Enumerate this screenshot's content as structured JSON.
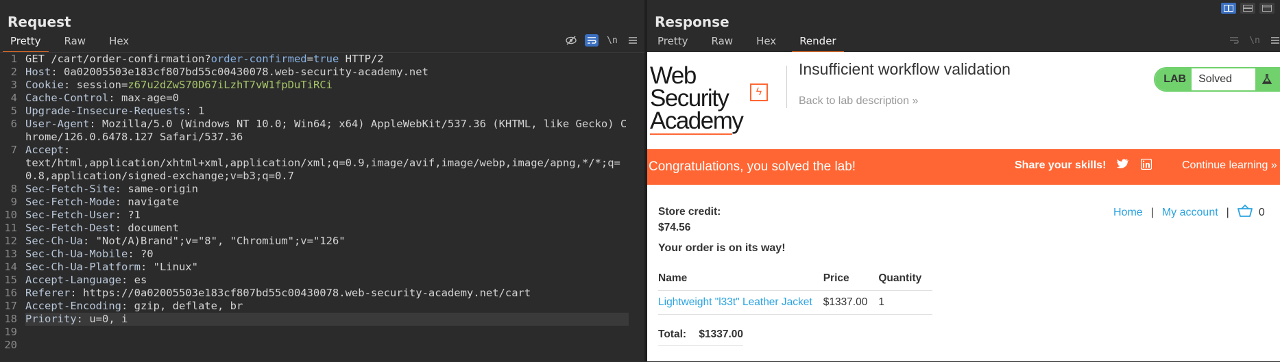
{
  "request": {
    "title": "Request",
    "tabs": [
      "Pretty",
      "Raw",
      "Hex"
    ],
    "active_tab": "Pretty",
    "tool_newline": "\\n",
    "lines": [
      {
        "n": "1",
        "segments": [
          [
            "GET /cart/order-confirmation?",
            ""
          ],
          [
            "order-confirmed",
            "q"
          ],
          [
            "=",
            ""
          ],
          [
            "true",
            "q"
          ],
          [
            " HTTP/2",
            ""
          ]
        ]
      },
      {
        "n": "2",
        "segments": [
          [
            "Host",
            "hname"
          ],
          [
            ": 0a02005503e183cf807bd55c00430078.web-security-academy.net",
            "hval"
          ]
        ]
      },
      {
        "n": "3",
        "segments": [
          [
            "Cookie",
            "hname"
          ],
          [
            ": session=",
            "hval"
          ],
          [
            "z67u2dZwS70D67iLzhT7vW1fpDuTiRCi",
            "sess"
          ]
        ]
      },
      {
        "n": "4",
        "segments": [
          [
            "Cache-Control",
            "hname"
          ],
          [
            ": max-age=0",
            "hval"
          ]
        ]
      },
      {
        "n": "5",
        "segments": [
          [
            "Upgrade-Insecure-Requests",
            "hname"
          ],
          [
            ": 1",
            "hval"
          ]
        ]
      },
      {
        "n": "6",
        "segments": [
          [
            "User-Agent",
            "hname"
          ],
          [
            ": Mozilla/5.0 (Windows NT 10.0; Win64; x64) AppleWebKit/537.36 (KHTML, like Gecko) Chrome/126.0.6478.127 Safari/537.36",
            "hval"
          ]
        ]
      },
      {
        "n": "7",
        "segments": [
          [
            "Accept",
            "hname"
          ],
          [
            ":\ntext/html,application/xhtml+xml,application/xml;q=0.9,image/avif,image/webp,image/apng,*/*;q=0.8,application/signed-exchange;v=b3;q=0.7",
            "hval"
          ]
        ]
      },
      {
        "n": "8",
        "segments": [
          [
            "Sec-Fetch-Site",
            "hname"
          ],
          [
            ": same-origin",
            "hval"
          ]
        ]
      },
      {
        "n": "9",
        "segments": [
          [
            "Sec-Fetch-Mode",
            "hname"
          ],
          [
            ": navigate",
            "hval"
          ]
        ]
      },
      {
        "n": "10",
        "segments": [
          [
            "Sec-Fetch-User",
            "hname"
          ],
          [
            ": ?1",
            "hval"
          ]
        ]
      },
      {
        "n": "11",
        "segments": [
          [
            "Sec-Fetch-Dest",
            "hname"
          ],
          [
            ": document",
            "hval"
          ]
        ]
      },
      {
        "n": "12",
        "segments": [
          [
            "Sec-Ch-Ua",
            "hname"
          ],
          [
            ": \"Not/A)Brand\";v=\"8\", \"Chromium\";v=\"126\"",
            "hval"
          ]
        ]
      },
      {
        "n": "13",
        "segments": [
          [
            "Sec-Ch-Ua-Mobile",
            "hname"
          ],
          [
            ": ?0",
            "hval"
          ]
        ]
      },
      {
        "n": "14",
        "segments": [
          [
            "Sec-Ch-Ua-Platform",
            "hname"
          ],
          [
            ": \"Linux\"",
            "hval"
          ]
        ]
      },
      {
        "n": "15",
        "segments": [
          [
            "Accept-Language",
            "hname"
          ],
          [
            ": es",
            "hval"
          ]
        ]
      },
      {
        "n": "16",
        "segments": [
          [
            "Referer",
            "hname"
          ],
          [
            ": https://0a02005503e183cf807bd55c00430078.web-security-academy.net/cart",
            "hval"
          ]
        ]
      },
      {
        "n": "17",
        "segments": [
          [
            "Accept-Encoding",
            "hname"
          ],
          [
            ": gzip, deflate, br",
            "hval"
          ]
        ]
      },
      {
        "n": "18",
        "segments": [
          [
            "Priority",
            "hname"
          ],
          [
            ": u=0, i",
            "hval"
          ]
        ],
        "highlight": true
      },
      {
        "n": "19",
        "segments": [
          [
            "",
            ""
          ]
        ]
      },
      {
        "n": "20",
        "segments": [
          [
            "",
            ""
          ]
        ]
      }
    ]
  },
  "response": {
    "title": "Response",
    "tabs": [
      "Pretty",
      "Raw",
      "Hex",
      "Render"
    ],
    "active_tab": "Render",
    "tool_newline": "\\n",
    "page": {
      "logo_line1": "Web Security",
      "logo_line2": "Academy",
      "lab_title": "Insufficient workflow validation",
      "back_link": "Back to lab description",
      "back_chevron": "»",
      "lab_label": "LAB",
      "lab_status": "Solved",
      "banner_message": "Congratulations, you solved the lab!",
      "share_label": "Share your skills!",
      "continue_label": "Continue learning",
      "continue_chevron": "»",
      "store_credit_label": "Store credit:",
      "store_credit_value": "$74.56",
      "nav_home": "Home",
      "nav_sep": "|",
      "nav_account": "My account",
      "cart_count": "0",
      "order_message": "Your order is on its way!",
      "table_headers": [
        "Name",
        "Price",
        "Quantity"
      ],
      "order_rows": [
        {
          "name": "Lightweight \"l33t\" Leather Jacket",
          "price": "$1337.00",
          "quantity": "1"
        }
      ],
      "total_label": "Total:",
      "total_value": "$1337.00"
    }
  },
  "colors": {
    "accent_orange": "#ff6633",
    "lab_green": "#70d16d",
    "link_blue": "#29a3e0",
    "toggle_blue": "#3b6fc0"
  }
}
